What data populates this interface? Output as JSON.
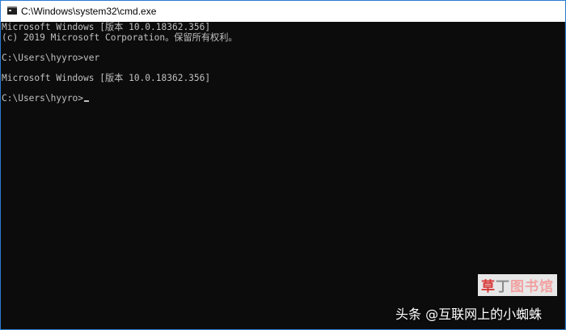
{
  "window": {
    "title": "C:\\Windows\\system32\\cmd.exe",
    "icon": "cmd-console-icon"
  },
  "console": {
    "lines": [
      "Microsoft Windows [版本 10.0.18362.356]",
      "(c) 2019 Microsoft Corporation。保留所有权利。",
      "",
      "C:\\Users\\hyyro>ver",
      "",
      "Microsoft Windows [版本 10.0.18362.356]",
      "",
      "C:\\Users\\hyyro>"
    ]
  },
  "watermark": {
    "logo_first": "草",
    "logo_mid": "丁",
    "logo_rest": "图书馆",
    "caption": "头条 @互联网上的小蜘蛛"
  },
  "colors": {
    "background": "#0c0c0c",
    "text": "#c0c0c0",
    "titlebar": "#ffffff",
    "border": "#2b7cd3"
  }
}
